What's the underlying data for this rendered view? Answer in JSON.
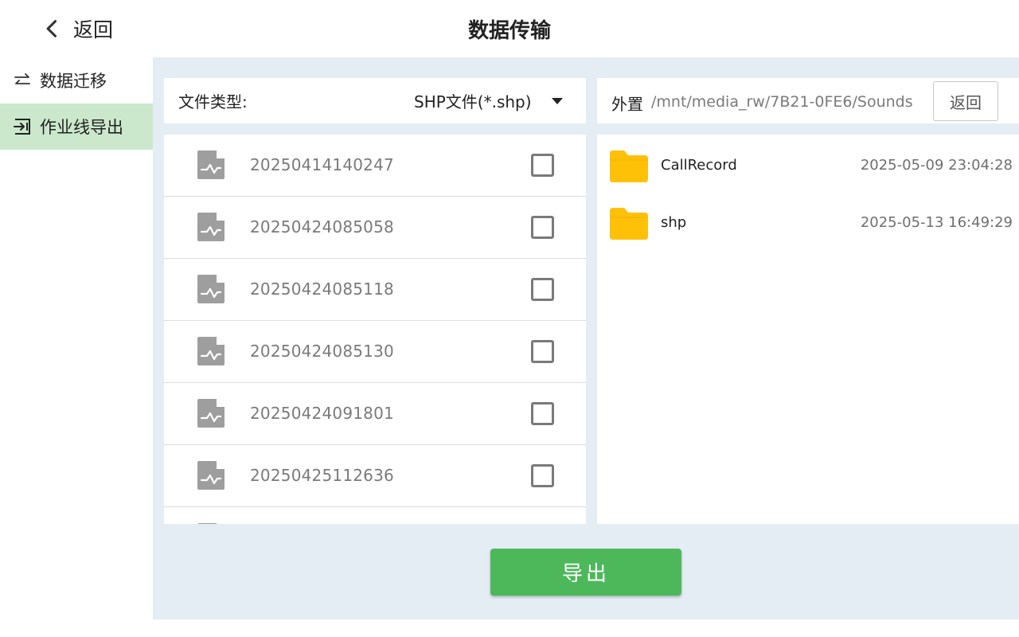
{
  "header": {
    "back_label": "返回",
    "title": "数据传输"
  },
  "sidebar": {
    "items": [
      {
        "label": "数据迁移",
        "icon": "swap-arrows-icon",
        "active": false
      },
      {
        "label": "作业线导出",
        "icon": "export-icon",
        "active": true
      }
    ]
  },
  "file_type": {
    "label": "文件类型:",
    "value": "SHP文件(*.shp)"
  },
  "files": [
    {
      "name": "20250414140247",
      "checked": false
    },
    {
      "name": "20250424085058",
      "checked": false
    },
    {
      "name": "20250424085118",
      "checked": false
    },
    {
      "name": "20250424085130",
      "checked": false
    },
    {
      "name": "20250424091801",
      "checked": false
    },
    {
      "name": "20250425112636",
      "checked": false
    }
  ],
  "location": {
    "prefix": "外置",
    "path": "/mnt/media_rw/7B21-0FE6/Sounds",
    "back_label": "返回"
  },
  "folders": [
    {
      "name": "CallRecord",
      "date": "2025-05-09 23:04:28"
    },
    {
      "name": "shp",
      "date": "2025-05-13 16:49:29"
    }
  ],
  "export_label": "导出",
  "colors": {
    "accent": "#4cb85a",
    "active_bg": "#cbe8cc",
    "folder": "#ffc107",
    "panel_bg": "#e3edf3"
  }
}
